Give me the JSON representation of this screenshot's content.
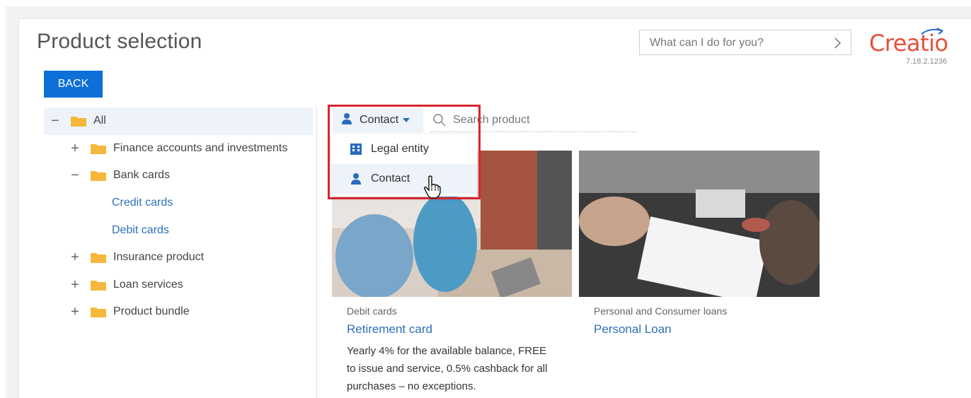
{
  "header": {
    "title": "Product selection",
    "command_placeholder": "What can I do for you?",
    "logo_text": "Creatio",
    "version": "7.18.2.1236"
  },
  "toolbar": {
    "back_label": "BACK"
  },
  "tree": {
    "items": [
      {
        "label": "All",
        "toggle": "−",
        "folder": true,
        "selected": true
      },
      {
        "label": "Finance accounts and investments",
        "toggle": "+",
        "folder": true
      },
      {
        "label": "Bank cards",
        "toggle": "−",
        "folder": true
      },
      {
        "label": "Credit cards",
        "link": true
      },
      {
        "label": "Debit cards",
        "link": true
      },
      {
        "label": "Insurance product",
        "toggle": "+",
        "folder": true
      },
      {
        "label": "Loan services",
        "toggle": "+",
        "folder": true
      },
      {
        "label": "Product bundle",
        "toggle": "+",
        "folder": true
      }
    ]
  },
  "filter": {
    "selected": "Contact",
    "search_placeholder": "Search product",
    "options": [
      {
        "label": "Legal entity",
        "icon": "building-icon"
      },
      {
        "label": "Contact",
        "icon": "person-icon"
      }
    ]
  },
  "products": [
    {
      "category": "Debit cards",
      "name": "Retirement card",
      "description": [
        "Yearly 4% for the available balance, FREE",
        "to issue and service, 0.5% cashback for all",
        "purchases – no exceptions."
      ]
    },
    {
      "category": "Personal and Consumer loans",
      "name": "Personal Loan"
    }
  ],
  "colors": {
    "accent": "#0d6fd8",
    "link": "#2d6fb8",
    "brand": "#e94e3c",
    "highlight": "#d7262f",
    "folder": "#f5b83d"
  }
}
